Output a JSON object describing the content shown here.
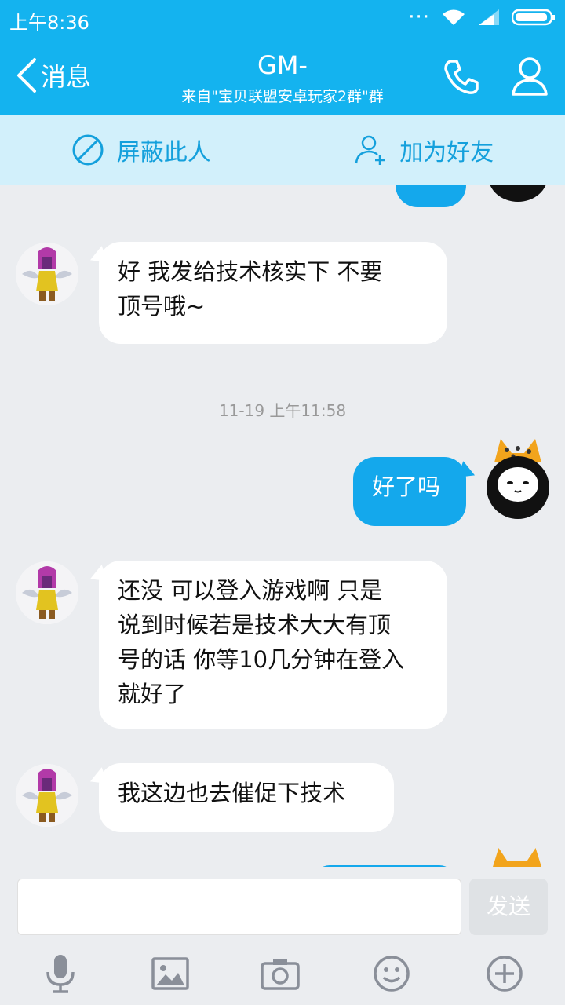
{
  "status": {
    "time": "上午8:36",
    "dots": "···"
  },
  "header": {
    "back_label": "消息",
    "title": "GM-",
    "subtitle": "来自\"宝贝联盟安卓玩家2群\"群"
  },
  "actions": {
    "block": "屏蔽此人",
    "add_friend": "加为好友"
  },
  "messages": [
    {
      "side": "left",
      "text_lines": [
        "好 我发给技术核实下  不要",
        "顶号哦~"
      ]
    },
    {
      "timestamp": "11-19 上午11:58"
    },
    {
      "side": "right",
      "text_lines": [
        "好了吗"
      ]
    },
    {
      "side": "left",
      "text_lines": [
        "还没  可以登入游戏啊  只是",
        "说到时候若是技术大大有顶",
        "号的话 你等10几分钟在登入",
        "就好了"
      ]
    },
    {
      "side": "left",
      "text_lines": [
        "我这边也去催促下技术"
      ]
    }
  ],
  "input": {
    "placeholder": "",
    "send_label": "发送"
  },
  "colors": {
    "accent": "#14b3ef",
    "bubble_right": "#14a8ec",
    "action_bar": "#d2f0fb"
  }
}
